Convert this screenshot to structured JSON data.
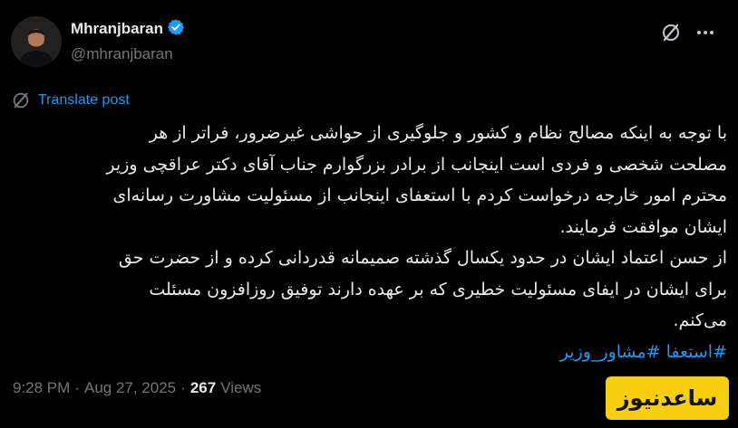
{
  "author": {
    "display_name": "Mhranjbaran",
    "handle": "@mhranjbaran",
    "verified": true,
    "verified_color": "#1d9bf0"
  },
  "actions": {
    "grok_icon": "grok-icon",
    "more_icon": "more-icon"
  },
  "translate": {
    "label": "Translate post",
    "icon": "translate-icon"
  },
  "post": {
    "lines": [
      "با توجه به اینکه مصالح نظام و کشور و جلوگیری از حواشی غیرضرور، فراتر از هر",
      "مصلحت شخصی و فردی است اینجانب از برادر بزرگوارم جناب آقای دکتر عراقچی وزیر",
      "محترم امور خارجه درخواست کردم با استعفای اینجانب از مسئولیت مشاورت رسانه‌ای",
      "ایشان موافقت فرمایند.",
      "از حسن اعتماد ایشان در حدود یکسال گذشته صمیمانه قدردانی کرده و از حضرت حق",
      "برای ایشان در ایفای مسئولیت خطیری که بر عهده دارند توفیق روزافزون مسئلت",
      "می‌کنم."
    ],
    "hashtags": [
      "#استعفا",
      "#مشاور_وزیر"
    ]
  },
  "meta": {
    "time": "9:28 PM",
    "sep1": "·",
    "date": "Aug 27, 2025",
    "sep2": "·",
    "views_count": "267",
    "views_label": "Views"
  },
  "watermark": {
    "text": "ساعدنیوز"
  },
  "colors": {
    "background": "#000000",
    "text": "#e7e9ea",
    "secondary": "#71767b",
    "link": "#1d9bf0",
    "watermark_bg": "#f6cf10"
  }
}
